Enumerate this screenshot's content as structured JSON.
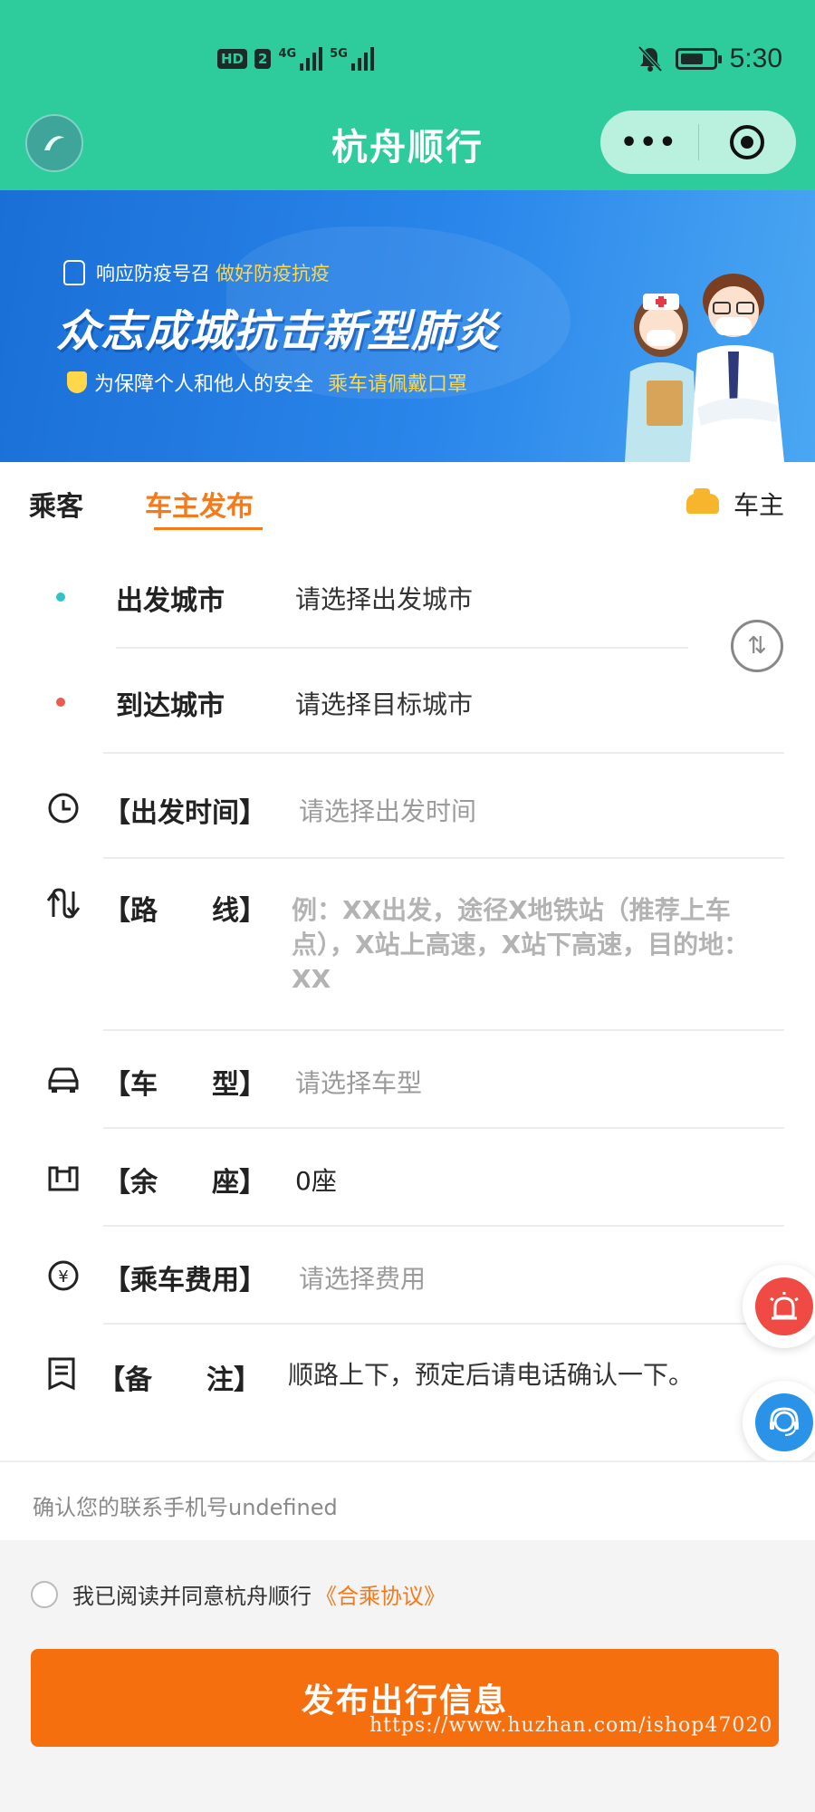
{
  "status_bar": {
    "hd_label": "HD",
    "sim": "2",
    "net1": "4G",
    "net2": "5G",
    "time": "5:30"
  },
  "nav": {
    "title": "杭舟顺行",
    "more_label": "•••"
  },
  "banner": {
    "line1_prefix": "响应防疫号召",
    "line1_highlight": "做好防疫抗疫",
    "headline": "众志成城抗击新型肺炎",
    "sub_prefix": "为保障个人和他人的安全",
    "sub_highlight": "乘车请佩戴口罩"
  },
  "tabs": {
    "passenger": "乘客",
    "driver_publish": "车主发布",
    "role_label": "车主"
  },
  "form": {
    "depart_city": {
      "label": "出发城市",
      "placeholder": "请选择出发城市"
    },
    "arrive_city": {
      "label": "到达城市",
      "placeholder": "请选择目标城市"
    },
    "depart_time": {
      "label": "【出发时间】",
      "placeholder": "请选择出发时间"
    },
    "route": {
      "label": "【路　　线】",
      "placeholder": "例：XX出发，途径X地铁站（推荐上车点），X站上高速，X站下高速，目的地：XX"
    },
    "car_type": {
      "label": "【车　　型】",
      "placeholder": "请选择车型"
    },
    "seats": {
      "label": "【余　　座】",
      "value": "0座"
    },
    "fare": {
      "label": "【乘车费用】",
      "placeholder": "请选择费用"
    },
    "remark": {
      "label": "【备　　注】",
      "value": "顺路上下，预定后请电话确认一下。"
    }
  },
  "phone_confirm": "确认您的联系手机号undefined",
  "agreement": {
    "prefix": "我已阅读并同意杭舟顺行",
    "link": "《合乘协议》"
  },
  "submit_label": "发布出行信息",
  "watermark": "https://www.huzhan.com/ishop47020",
  "colors": {
    "brand_green": "#2ecb9c",
    "accent_orange": "#f47a1b",
    "submit_orange": "#f56f0f",
    "banner_blue": "#2a86ea"
  }
}
